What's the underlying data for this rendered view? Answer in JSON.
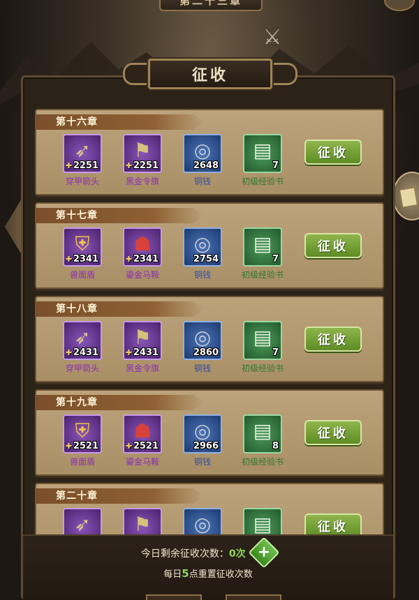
{
  "header": {
    "top_banner": "第二十三章",
    "title": "征收"
  },
  "chapters": [
    {
      "name": "第十六章",
      "items": [
        {
          "label": "穿甲箭头",
          "qty": "2251",
          "rarity": "purple",
          "icon": "arrowhead-icon"
        },
        {
          "label": "黑金令旗",
          "qty": "2251",
          "rarity": "purple",
          "icon": "flag-icon"
        },
        {
          "label": "铜钱",
          "qty": "2648",
          "rarity": "blue",
          "icon": "coin-icon"
        },
        {
          "label": "初级经验书",
          "qty": "7",
          "rarity": "green",
          "icon": "book-icon"
        }
      ],
      "button": "征收"
    },
    {
      "name": "第十七章",
      "items": [
        {
          "label": "兽面盾",
          "qty": "2341",
          "rarity": "purple",
          "icon": "shield-icon"
        },
        {
          "label": "鎏金马鞍",
          "qty": "2341",
          "rarity": "purple",
          "icon": "saddle-icon"
        },
        {
          "label": "铜钱",
          "qty": "2754",
          "rarity": "blue",
          "icon": "coin-icon"
        },
        {
          "label": "初级经验书",
          "qty": "7",
          "rarity": "green",
          "icon": "book-icon"
        }
      ],
      "button": "征收"
    },
    {
      "name": "第十八章",
      "items": [
        {
          "label": "穿甲箭头",
          "qty": "2431",
          "rarity": "purple",
          "icon": "arrowhead-icon"
        },
        {
          "label": "黑金令旗",
          "qty": "2431",
          "rarity": "purple",
          "icon": "flag-icon"
        },
        {
          "label": "铜钱",
          "qty": "2860",
          "rarity": "blue",
          "icon": "coin-icon"
        },
        {
          "label": "初级经验书",
          "qty": "7",
          "rarity": "green",
          "icon": "book-icon"
        }
      ],
      "button": "征收"
    },
    {
      "name": "第十九章",
      "items": [
        {
          "label": "兽面盾",
          "qty": "2521",
          "rarity": "purple",
          "icon": "shield-icon"
        },
        {
          "label": "鎏金马鞍",
          "qty": "2521",
          "rarity": "purple",
          "icon": "saddle-icon"
        },
        {
          "label": "铜钱",
          "qty": "2966",
          "rarity": "blue",
          "icon": "coin-icon"
        },
        {
          "label": "初级经验书",
          "qty": "8",
          "rarity": "green",
          "icon": "book-icon"
        }
      ],
      "button": "征收"
    },
    {
      "name": "第二十章",
      "items": [
        {
          "label": "",
          "qty": "",
          "rarity": "purple",
          "icon": "arrowhead-icon"
        },
        {
          "label": "",
          "qty": "",
          "rarity": "purple",
          "icon": "flag-icon"
        },
        {
          "label": "",
          "qty": "",
          "rarity": "blue",
          "icon": "coin-icon"
        },
        {
          "label": "",
          "qty": "",
          "rarity": "green",
          "icon": "book-icon"
        }
      ],
      "button": "征收"
    }
  ],
  "footer": {
    "remaining_prefix": "今日剩余征收次数：",
    "remaining_count": "0次",
    "reset_prefix": "每日",
    "reset_hour": "5",
    "reset_suffix": "点重置征收次数"
  },
  "colors": {
    "purple": "#8b2fb5",
    "blue": "#2f4fa8",
    "green": "#2e7a2e",
    "button_green": "#7aa63b"
  }
}
